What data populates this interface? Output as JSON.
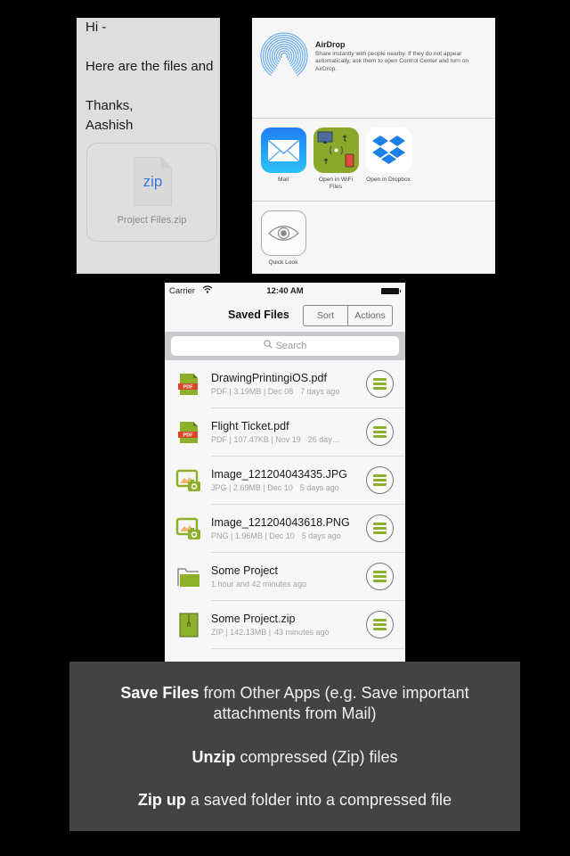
{
  "mail_preview": {
    "greeting": "Hi -",
    "body": "Here are the files and",
    "signoff": "Thanks,",
    "sender": "Aashish",
    "attachment": {
      "icon": "zip-file-icon",
      "type_label": "zip",
      "filename": "Project Files.zip"
    }
  },
  "share_sheet": {
    "airdrop": {
      "icon": "airdrop-icon",
      "title": "AirDrop",
      "description": "Share instantly with people nearby. If they do not appear automatically, ask them to open Control Center and turn on AirDrop."
    },
    "apps": [
      {
        "icon": "mail-icon",
        "label": "Mail"
      },
      {
        "icon": "wifi-files-icon",
        "label": "Open in WiFi Files"
      },
      {
        "icon": "dropbox-icon",
        "label": "Open in Dropbox"
      }
    ],
    "actions": [
      {
        "icon": "quick-look-eye-icon",
        "label": "Quick Look"
      }
    ]
  },
  "phone": {
    "status_bar": {
      "carrier": "Carrier",
      "wifi_icon": "wifi-icon",
      "time": "12:40 AM",
      "battery_icon": "battery-icon"
    },
    "nav": {
      "title": "Saved Files",
      "sort_label": "Sort",
      "actions_label": "Actions"
    },
    "search": {
      "placeholder": "Search",
      "icon": "search-icon"
    },
    "files": [
      {
        "name": "DrawingPrintingiOS.pdf",
        "meta": "PDF | 3.19MB | Dec 08",
        "ago": "7 days ago",
        "icon": "pdf-file-icon"
      },
      {
        "name": "Flight Ticket.pdf",
        "meta": "PDF | 107.47KB | Nov 19",
        "ago": "26 day…",
        "icon": "pdf-file-icon"
      },
      {
        "name": "Image_121204043435.JPG",
        "meta": "JPG | 2.69MB | Dec 10",
        "ago": "5 days ago",
        "icon": "image-file-icon"
      },
      {
        "name": "Image_121204043618.PNG",
        "meta": "PNG | 1.96MB | Dec 10",
        "ago": "5 days ago",
        "icon": "image-file-icon"
      },
      {
        "name": "Some Project",
        "meta": "1 hour and 42 minutes ago",
        "ago": "",
        "icon": "folder-icon"
      },
      {
        "name": "Some Project.zip",
        "meta": "ZIP | 142.13MB |",
        "ago": "43 minutes ago",
        "icon": "zip-archive-icon"
      }
    ]
  },
  "caption": {
    "line1_bold": "Save Files",
    "line1_rest": " from Other Apps (e.g. Save important attachments from Mail)",
    "line2_bold": "Unzip",
    "line2_rest": " compressed (Zip) files",
    "line3_bold": "Zip up",
    "line3_rest": " a saved folder into a compressed file"
  },
  "colors": {
    "accent_green": "#8db02b",
    "pdf_red": "#d9452b",
    "airdrop_blue": "#6aaef0",
    "caption_bg": "#434343"
  }
}
